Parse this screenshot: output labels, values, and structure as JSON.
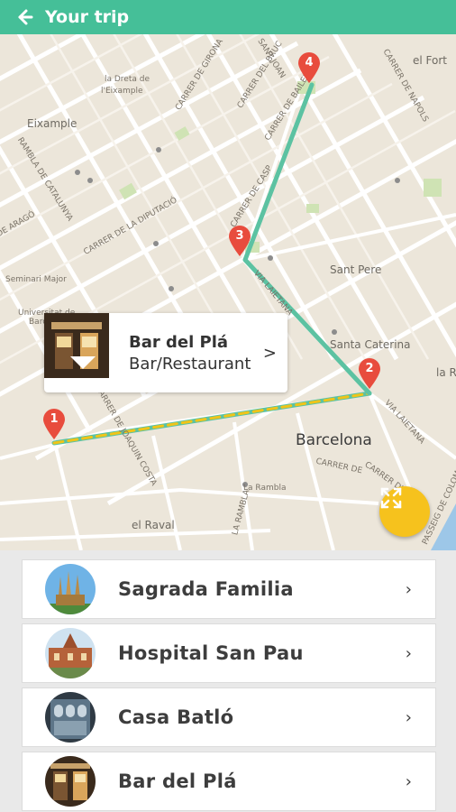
{
  "header": {
    "title": "Your trip",
    "back_icon": "arrow-left-icon",
    "background": "#45bf98"
  },
  "map": {
    "district_labels": {
      "eixample": "Eixample",
      "dreta": "la Dreta de",
      "dreta2": "l'Eixample",
      "fort": "el Fort",
      "sant_pere": "Sant Pere",
      "santa_caterina": "Santa Caterina",
      "barcelona": "Barcelona",
      "raval": "el Raval",
      "seminari": "Seminari Major",
      "universitat": "Universitat de",
      "barc": "Barc",
      "la_rambla": "La Rambla",
      "la_r": "la R"
    },
    "street_labels": {
      "girona": "CARRER DE GIRONA",
      "bruc": "CARRER DEL BRUC",
      "sant_joan": "SANT JOAN",
      "ballen": "CARRER DE BAILEN",
      "napols": "CARRER DE NAPOLS",
      "casp": "CARRER DE CASP",
      "diputacio": "CARRER DE LA DIPUTACIÓ",
      "catalunya": "RAMBLA DE CATALUNYA",
      "arago": "DE ARAGÓ",
      "via_laietana": "VIA LAIETANA",
      "via_laietana2": "VIA LAIETANA",
      "joaquin_costa": "CARRER DE JOAQUIN COSTA",
      "la_rambla_st": "LA RAMBLA",
      "avinyo": "CARRER D'AVINYÓ",
      "colom": "PASSEIG DE COLOM",
      "carrer_de": "CARRER DE"
    },
    "route_colors": {
      "main": "#5cc2a2",
      "highlight": "#f0c419"
    },
    "stops": [
      "1",
      "2",
      "3",
      "4"
    ],
    "pin_color": "#e84c3d",
    "expand_icon": "expand-icon",
    "fab_color": "#f6c21d"
  },
  "callout": {
    "name": "Bar del Plá",
    "type": "Bar/Restaurant",
    "arrow": ">",
    "image_icon": "bar-photo-icon"
  },
  "places": [
    {
      "name": "Sagrada Familia",
      "icon": "sagrada-familia-photo-icon",
      "chevron": "›"
    },
    {
      "name": "Hospital San Pau",
      "icon": "hospital-photo-icon",
      "chevron": "›"
    },
    {
      "name": "Casa Batló",
      "icon": "casa-batllo-photo-icon",
      "chevron": "›"
    },
    {
      "name": "Bar del Plá",
      "icon": "bar-photo-icon",
      "chevron": "›"
    }
  ]
}
